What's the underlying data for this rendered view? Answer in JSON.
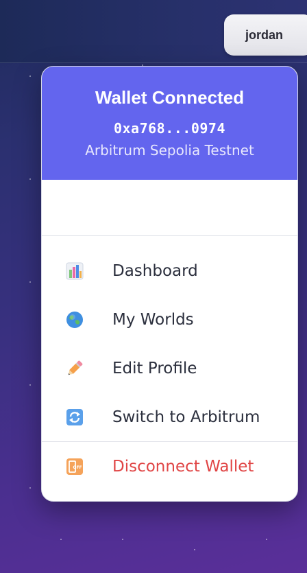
{
  "header": {
    "user_name": "jordan"
  },
  "wallet": {
    "title": "Wallet Connected",
    "address": "0xa768...0974",
    "network": "Arbitrum Sepolia Testnet",
    "header_color": "#6365ee"
  },
  "menu": {
    "items": [
      {
        "label": "Dashboard",
        "icon": "bar-chart-icon"
      },
      {
        "label": "My Worlds",
        "icon": "globe-icon"
      },
      {
        "label": "Edit Profile",
        "icon": "pencil-icon"
      },
      {
        "label": "Switch to Arbitrum",
        "icon": "switch-arrows-icon"
      }
    ],
    "disconnect": {
      "label": "Disconnect Wallet",
      "icon": "power-off-icon",
      "color": "#e04545"
    }
  }
}
